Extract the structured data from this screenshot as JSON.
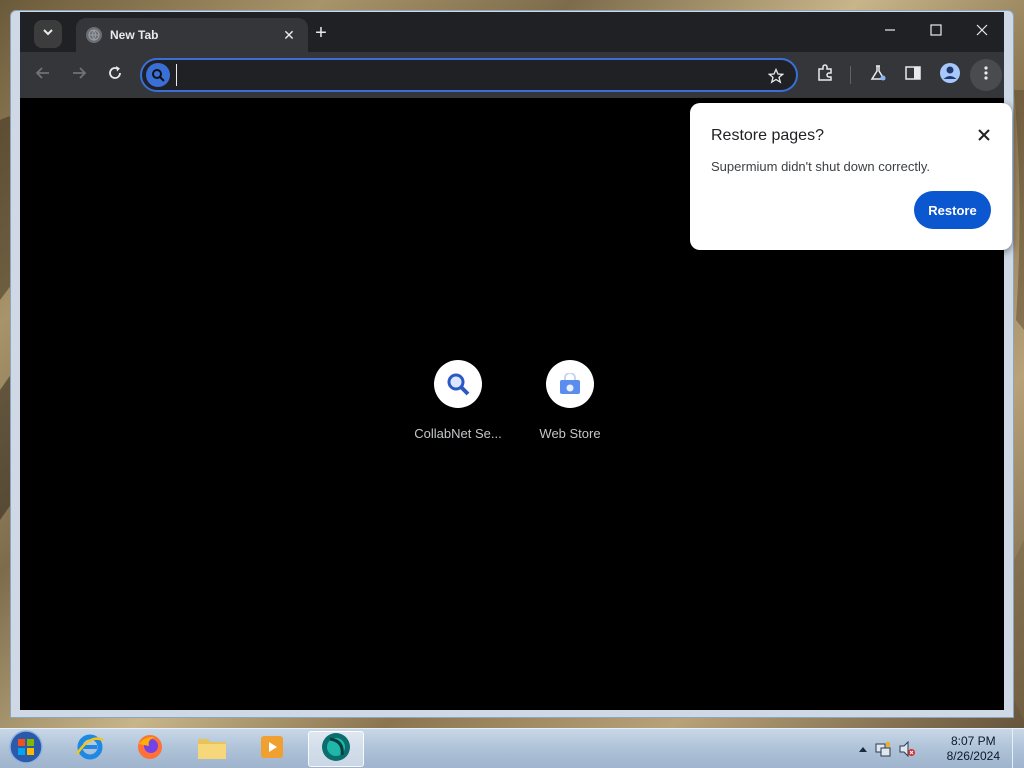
{
  "browser": {
    "tab": {
      "title": "New Tab"
    },
    "omnibox": {
      "value": "",
      "placeholder": ""
    }
  },
  "shortcuts": [
    {
      "label": "CollabNet Se...",
      "icon": "magnifier-icon"
    },
    {
      "label": "Web Store",
      "icon": "web-store-icon"
    }
  ],
  "popup": {
    "title": "Restore pages?",
    "message": "Supermium didn't shut down correctly.",
    "button": "Restore"
  },
  "taskbar": {
    "time": "8:07 PM",
    "date": "8/26/2024"
  },
  "colors": {
    "accent": "#0b57d0",
    "tab_bg": "#35363a",
    "tabstrip_bg": "#202124",
    "omnibox_border": "#3a6fd8"
  }
}
